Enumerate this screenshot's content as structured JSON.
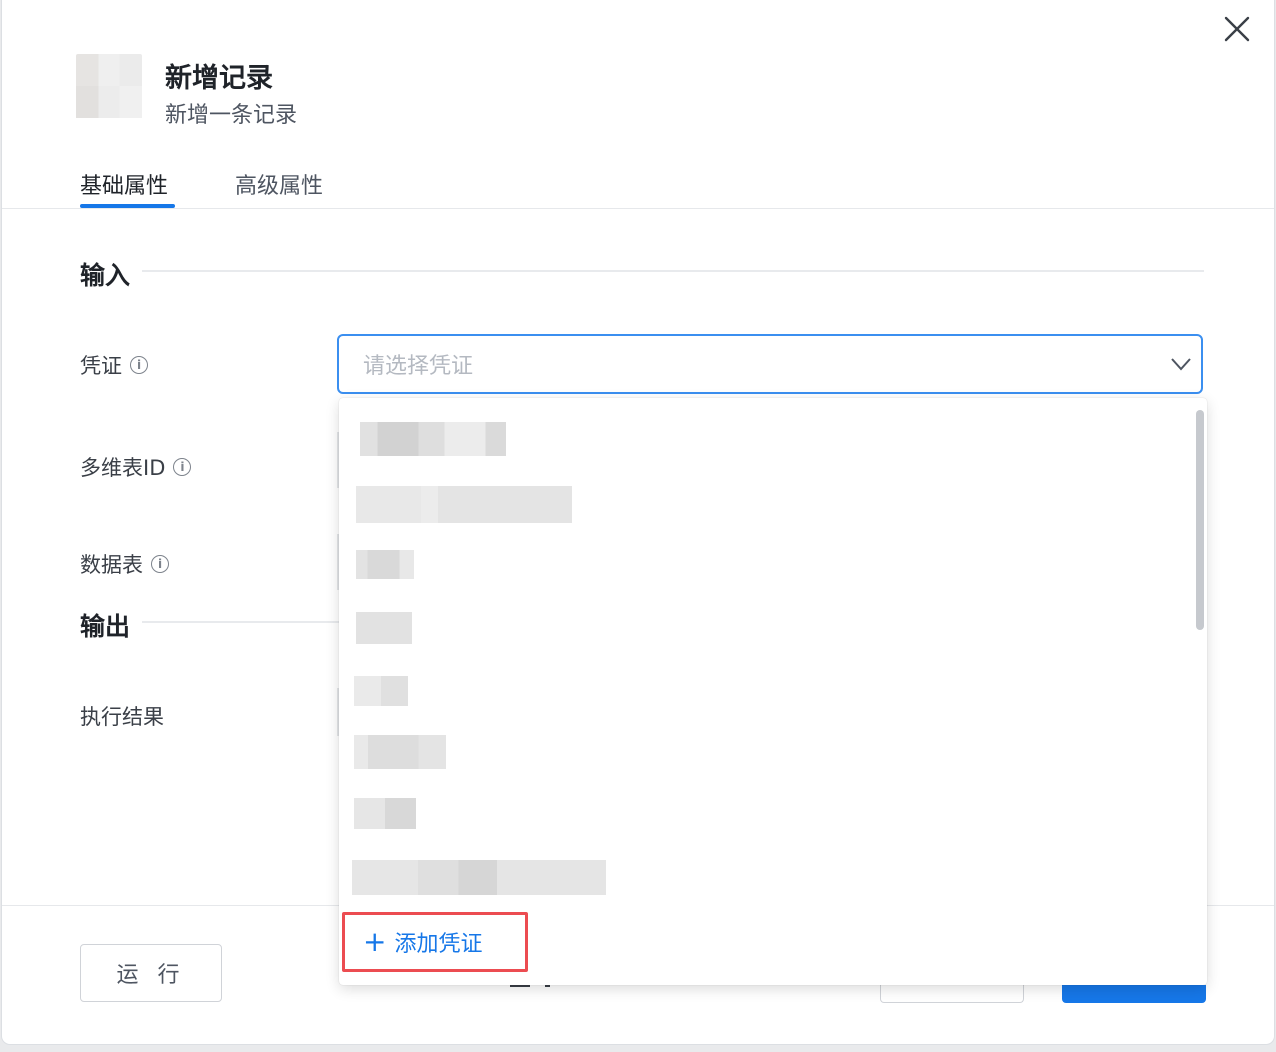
{
  "header": {
    "title": "新增记录",
    "subtitle": "新增一条记录"
  },
  "tabs": [
    {
      "label": "基础属性",
      "active": true
    },
    {
      "label": "高级属性",
      "active": false
    }
  ],
  "sections": {
    "input": "输入",
    "output": "输出"
  },
  "fields": {
    "credential": {
      "label": "凭证",
      "placeholder": "请选择凭证"
    },
    "table_id": {
      "label": "多维表ID"
    },
    "data_table": {
      "label": "数据表"
    },
    "result": {
      "label": "执行结果"
    }
  },
  "dropdown": {
    "add_label": "添加凭证"
  },
  "footer": {
    "run_label": "运 行"
  },
  "colors": {
    "accent": "#1677e8",
    "highlight_border": "#ec4c51"
  },
  "icons": {
    "close": "close-icon",
    "info": "info-icon",
    "chevron": "chevron-down-icon",
    "plus": "plus-icon"
  }
}
